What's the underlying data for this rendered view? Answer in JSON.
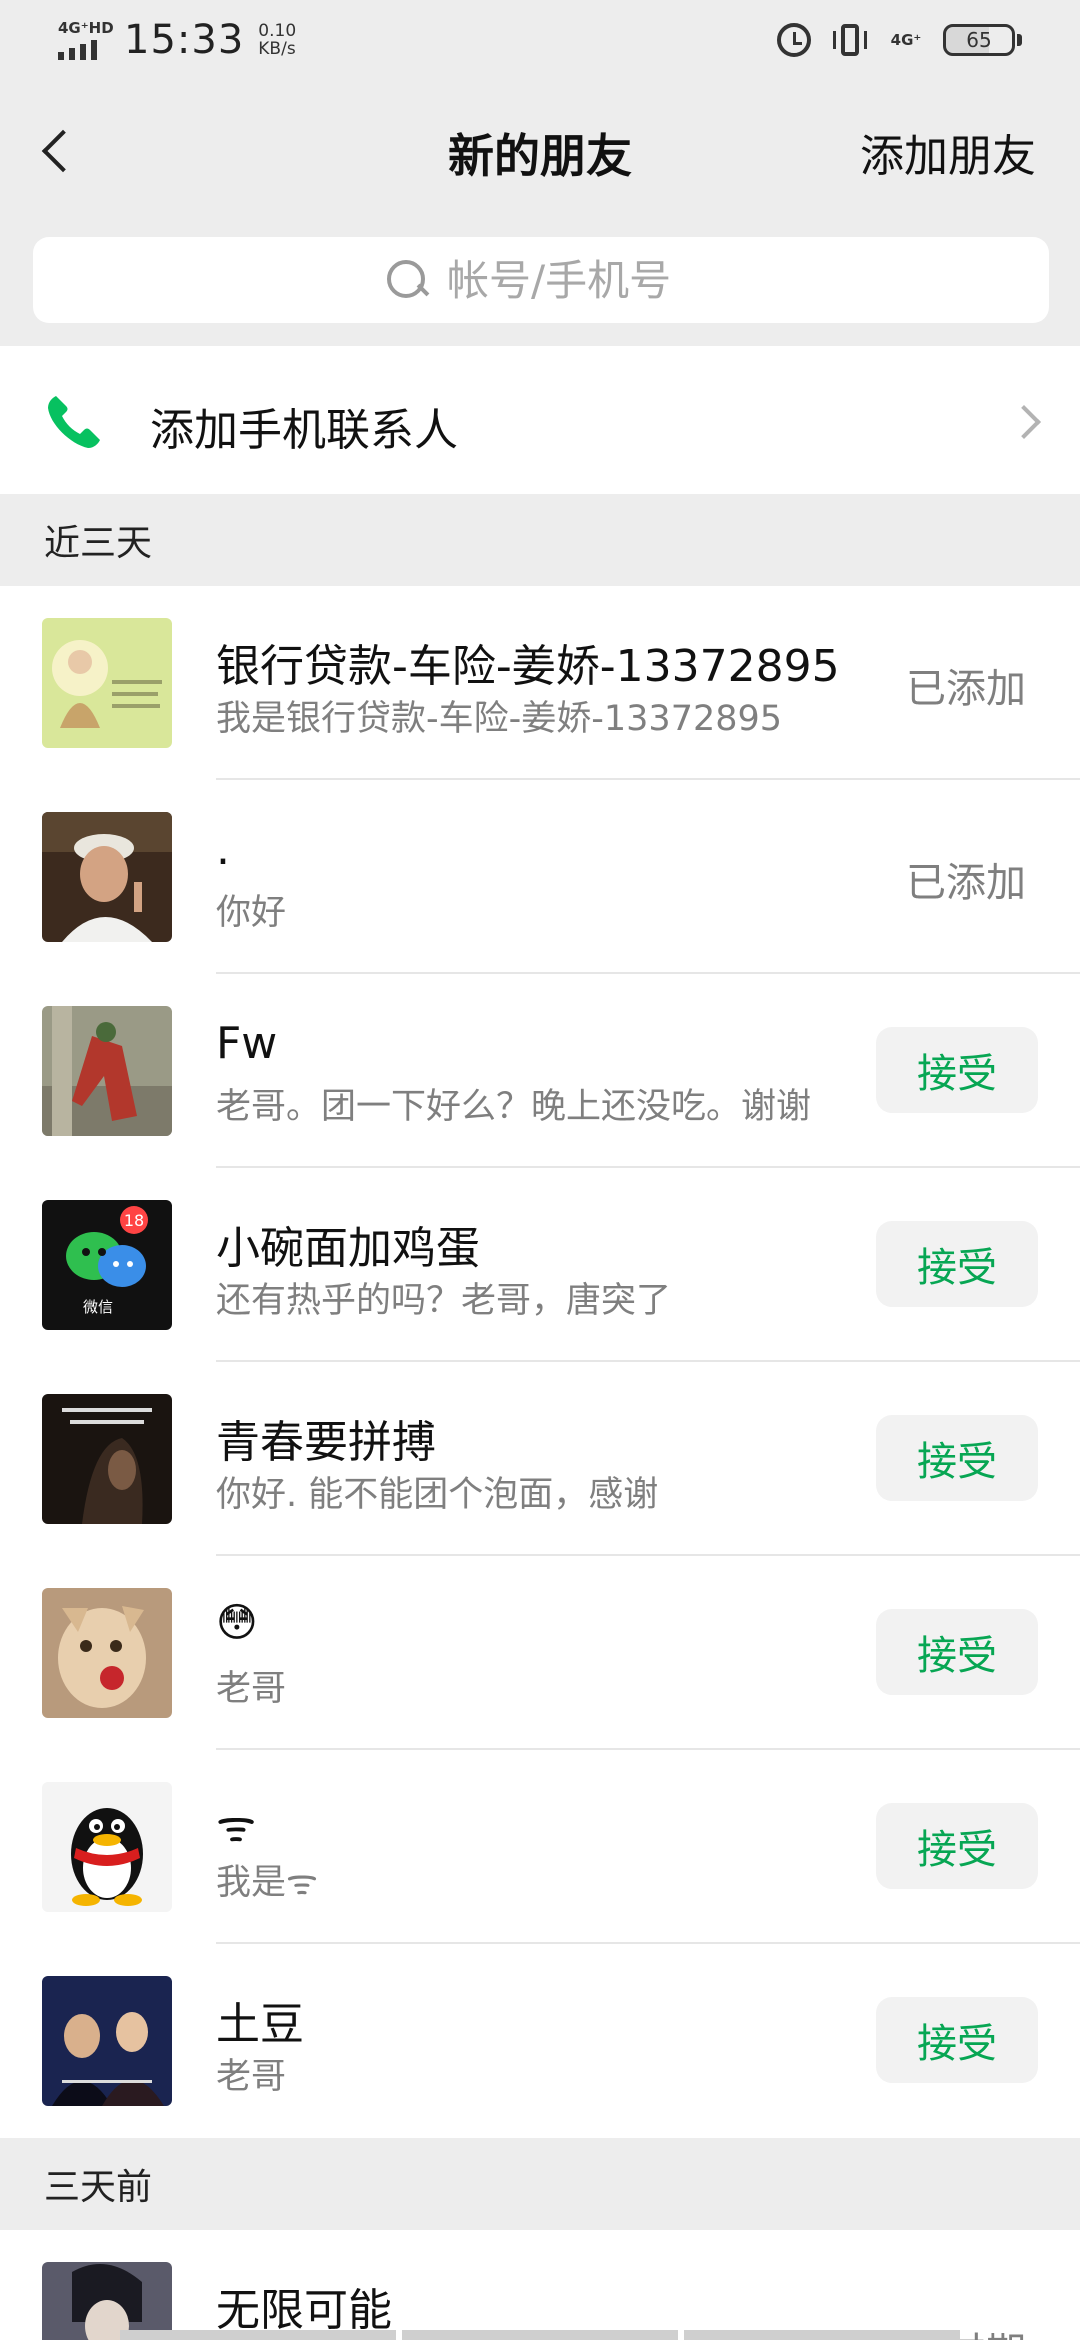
{
  "status_bar": {
    "network": "4G⁺HD",
    "time": "15:33",
    "speed_value": "0.10",
    "speed_unit": "KB/s",
    "network2": "4G⁺",
    "battery": "65"
  },
  "nav": {
    "back_icon": "chevron-left-icon",
    "title": "新的朋友",
    "action": "添加朋友"
  },
  "search": {
    "placeholder": "帐号/手机号",
    "value": ""
  },
  "phone_contacts": {
    "label": "添加手机联系人",
    "icon": "phone-icon"
  },
  "sections": [
    {
      "title": "近三天",
      "items": [
        {
          "name": "银行贷款-车险-姜娇-13372895",
          "message": "我是银行贷款-车险-姜娇-13372895",
          "action": "已添加",
          "type": "status"
        },
        {
          "name": ".",
          "message": "你好",
          "action": "已添加",
          "type": "status"
        },
        {
          "name": "Fw",
          "message": "老哥。团一下好么？晚上还没吃。谢谢",
          "action": "接受",
          "type": "button"
        },
        {
          "name": "小碗面加鸡蛋",
          "message": "还有热乎的吗？老哥，唐突了",
          "action": "接受",
          "type": "button"
        },
        {
          "name": "青春要拼搏",
          "message": "你好. 能不能团个泡面，感谢",
          "action": "接受",
          "type": "button"
        },
        {
          "name": "😳",
          "message": "老哥",
          "action": "接受",
          "type": "button"
        },
        {
          "name": "ᯤ",
          "message": "我是ᯤ",
          "action": "接受",
          "type": "button"
        },
        {
          "name": "土豆",
          "message": "老哥",
          "action": "接受",
          "type": "button"
        }
      ]
    },
    {
      "title": "三天前",
      "items": [
        {
          "name": "无限可能",
          "message": "",
          "action": "已过期",
          "type": "status"
        }
      ]
    }
  ],
  "avatar_badge": "18",
  "avatar_wechat_text": "微信",
  "colors": {
    "accent_green": "#07a653",
    "background": "#ededed"
  }
}
